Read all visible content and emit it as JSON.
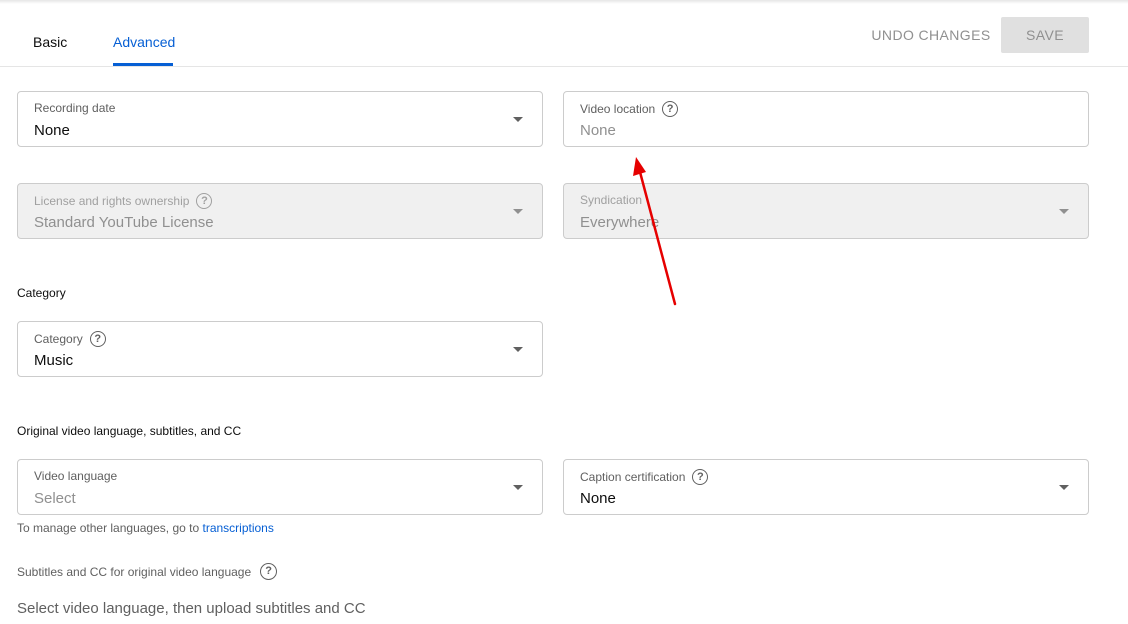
{
  "tabs": {
    "basic": "Basic",
    "advanced": "Advanced"
  },
  "actions": {
    "undo": "UNDO CHANGES",
    "save": "SAVE"
  },
  "fields": {
    "recording_date": {
      "label": "Recording date",
      "value": "None"
    },
    "video_location": {
      "label": "Video location",
      "value": "None"
    },
    "license": {
      "label": "License and rights ownership",
      "value": "Standard YouTube License"
    },
    "syndication": {
      "label": "Syndication",
      "value": "Everywhere"
    },
    "category": {
      "label": "Category",
      "value": "Music"
    },
    "video_language": {
      "label": "Video language",
      "value": "Select"
    },
    "caption_certification": {
      "label": "Caption certification",
      "value": "None"
    }
  },
  "sections": {
    "category": "Category",
    "language": "Original video language, subtitles, and CC"
  },
  "language_note": {
    "text": "To manage other languages, go to",
    "link": "transcriptions"
  },
  "subtitles": {
    "title": "Subtitles and CC for original video language",
    "description": "Select video language, then upload subtitles and CC"
  },
  "icons": {
    "help": "?"
  },
  "colors": {
    "accent": "#065fd4",
    "annotation_arrow": "#e60000"
  }
}
